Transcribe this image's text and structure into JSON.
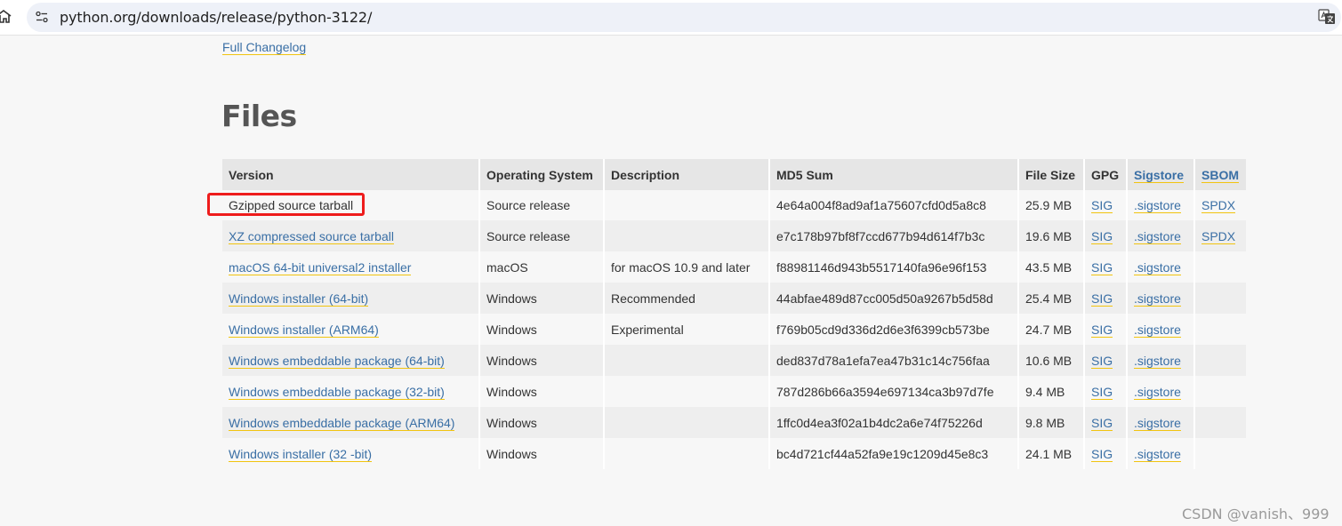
{
  "browser": {
    "url": "python.org/downloads/release/python-3122/"
  },
  "page": {
    "changelog_link": "Full Changelog",
    "files_heading": "Files"
  },
  "table": {
    "headers": {
      "version": "Version",
      "os": "Operating System",
      "description": "Description",
      "md5": "MD5 Sum",
      "size": "File Size",
      "gpg": "GPG",
      "sigstore": "Sigstore",
      "sbom": "SBOM"
    },
    "rows": [
      {
        "version": "Gzipped source tarball",
        "os": "Source release",
        "description": "",
        "md5": "4e64a004f8ad9af1a75607cfd0d5a8c8",
        "size": "25.9 MB",
        "gpg": "SIG",
        "sigstore": ".sigstore",
        "sbom": "SPDX"
      },
      {
        "version": "XZ compressed source tarball",
        "os": "Source release",
        "description": "",
        "md5": "e7c178b97bf8f7ccd677b94d614f7b3c",
        "size": "19.6 MB",
        "gpg": "SIG",
        "sigstore": ".sigstore",
        "sbom": "SPDX"
      },
      {
        "version": "macOS 64-bit universal2 installer",
        "os": "macOS",
        "description": "for macOS 10.9 and later",
        "md5": "f88981146d943b5517140fa96e96f153",
        "size": "43.5 MB",
        "gpg": "SIG",
        "sigstore": ".sigstore",
        "sbom": ""
      },
      {
        "version": "Windows installer (64-bit)",
        "os": "Windows",
        "description": "Recommended",
        "md5": "44abfae489d87cc005d50a9267b5d58d",
        "size": "25.4 MB",
        "gpg": "SIG",
        "sigstore": ".sigstore",
        "sbom": ""
      },
      {
        "version": "Windows installer (ARM64)",
        "os": "Windows",
        "description": "Experimental",
        "md5": "f769b05cd9d336d2d6e3f6399cb573be",
        "size": "24.7 MB",
        "gpg": "SIG",
        "sigstore": ".sigstore",
        "sbom": ""
      },
      {
        "version": "Windows embeddable package (64-bit)",
        "os": "Windows",
        "description": "",
        "md5": "ded837d78a1efa7ea47b31c14c756faa",
        "size": "10.6 MB",
        "gpg": "SIG",
        "sigstore": ".sigstore",
        "sbom": ""
      },
      {
        "version": "Windows embeddable package (32-bit)",
        "os": "Windows",
        "description": "",
        "md5": "787d286b66a3594e697134ca3b97d7fe",
        "size": "9.4 MB",
        "gpg": "SIG",
        "sigstore": ".sigstore",
        "sbom": ""
      },
      {
        "version": "Windows embeddable package (ARM64)",
        "os": "Windows",
        "description": "",
        "md5": "1ffc0d4ea3f02a1b4dc2a6e74f75226d",
        "size": "9.8 MB",
        "gpg": "SIG",
        "sigstore": ".sigstore",
        "sbom": ""
      },
      {
        "version": "Windows installer (32 -bit)",
        "os": "Windows",
        "description": "",
        "md5": "bc4d721cf44a52fa9e19c1209d45e8c3",
        "size": "24.1 MB",
        "gpg": "SIG",
        "sigstore": ".sigstore",
        "sbom": ""
      }
    ]
  },
  "watermark": "CSDN @vanish、999",
  "colors": {
    "link": "#3a6fa5",
    "link_underline": "#f1c40f",
    "highlight": "#ee1c1c",
    "header_bg": "#e6e6e6"
  },
  "icons": [
    "home-icon",
    "site-settings-icon",
    "translate-icon"
  ]
}
